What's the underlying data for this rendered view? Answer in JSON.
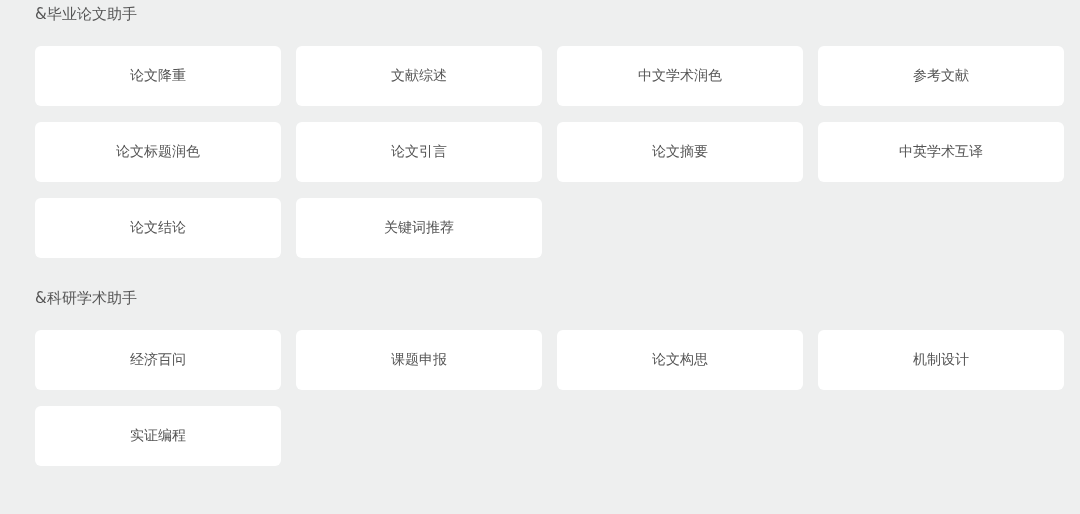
{
  "sections": [
    {
      "title": "&毕业论文助手",
      "items": [
        "论文降重",
        "文献综述",
        "中文学术润色",
        "参考文献",
        "论文标题润色",
        "论文引言",
        "论文摘要",
        "中英学术互译",
        "论文结论",
        "关键词推荐"
      ]
    },
    {
      "title": "&科研学术助手",
      "items": [
        "经济百问",
        "课题申报",
        "论文构思",
        "机制设计",
        "实证编程"
      ]
    }
  ]
}
